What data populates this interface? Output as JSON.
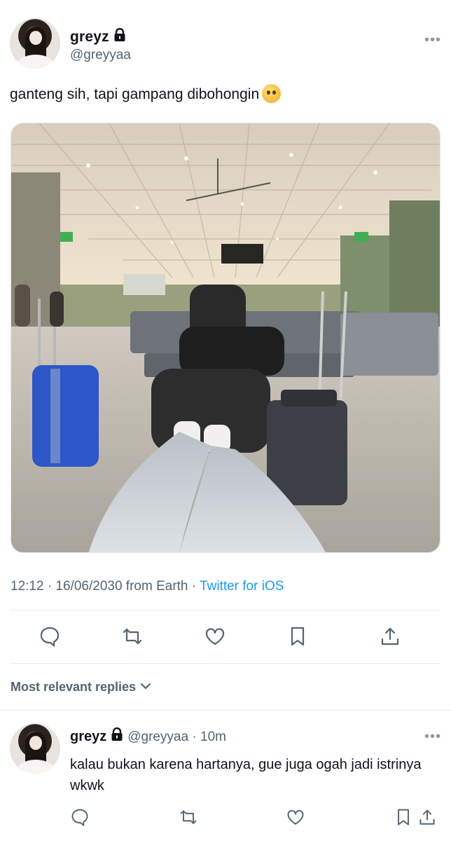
{
  "tweet": {
    "author": {
      "display_name": "greyz",
      "handle": "@greyyaa",
      "protected": true
    },
    "text": "ganteng sih, tapi gampang dibohongin",
    "emoji": "flushed-face-hands-over-mouth",
    "timestamp": "12:12 · 16/06/2030 from Earth · ",
    "source": "Twitter for iOS",
    "actions": [
      {
        "name": "reply",
        "icon": "speech-bubble-icon"
      },
      {
        "name": "retweet",
        "icon": "retweet-icon"
      },
      {
        "name": "like",
        "icon": "heart-icon"
      },
      {
        "name": "bookmark",
        "icon": "bookmark-icon"
      },
      {
        "name": "share",
        "icon": "share-icon"
      }
    ]
  },
  "replies_filter": {
    "label": "Most relevant replies"
  },
  "reply": {
    "author": {
      "display_name": "greyz",
      "handle": "@greyyaa",
      "protected": true
    },
    "meta": "@greyyaa · 10m",
    "text": "kalau bukan karena hartanya, gue juga ogah jadi istrinya wkwk"
  },
  "colors": {
    "link": "#1d9bf0",
    "muted": "#536471",
    "text": "#0f1419"
  }
}
